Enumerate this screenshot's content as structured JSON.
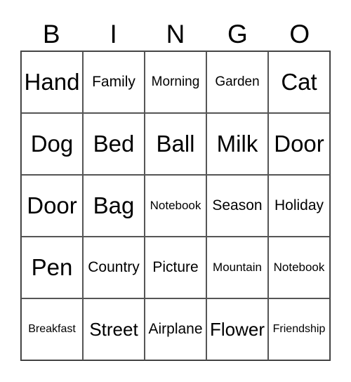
{
  "header": [
    "B",
    "I",
    "N",
    "G",
    "O"
  ],
  "cells": [
    [
      "Hand",
      "Family",
      "Morning",
      "Garden",
      "Cat"
    ],
    [
      "Dog",
      "Bed",
      "Ball",
      "Milk",
      "Door"
    ],
    [
      "Door",
      "Bag",
      "Notebook",
      "Season",
      "Holiday"
    ],
    [
      "Pen",
      "Country",
      "Picture",
      "Mountain",
      "Notebook"
    ],
    [
      "Breakfast",
      "Street",
      "Airplane",
      "Flower",
      "Friendship"
    ]
  ]
}
